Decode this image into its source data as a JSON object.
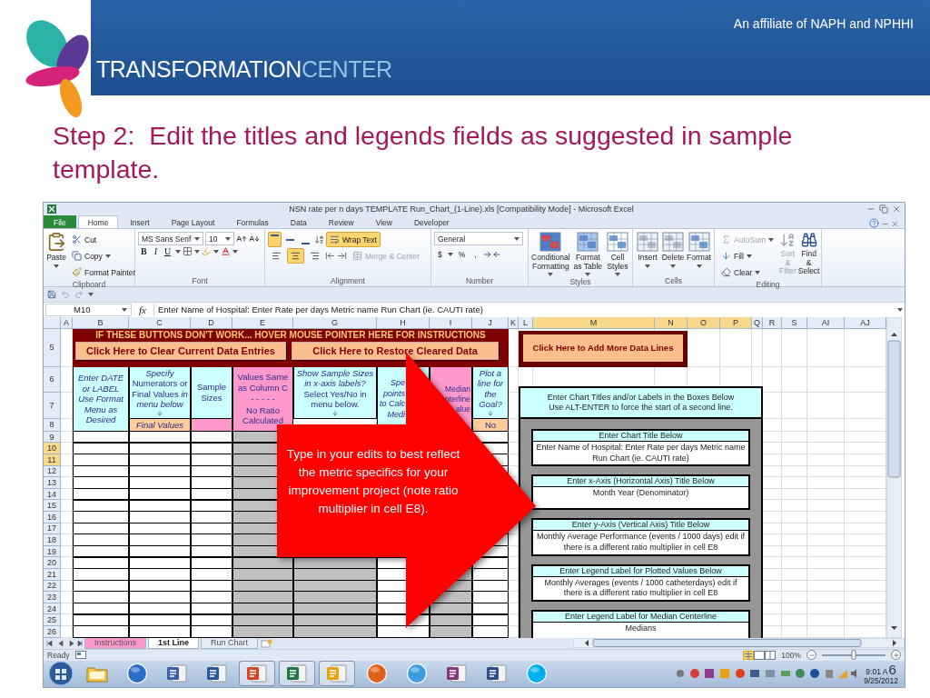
{
  "slide": {
    "affiliate": "An affiliate of NAPH and NPHHI",
    "logo_left": "TRANSFORMATION",
    "logo_right": "CENTER",
    "title": "Step 2:  Edit the titles and legends fields as suggested in sample template.",
    "callout": "Type in your edits to best reflect the metric specifics for your improvement project (note ratio multiplier in cell E8).",
    "slide_number": "6"
  },
  "window": {
    "title": "NSN rate per n days TEMPLATE Run_Chart_(1-Line).xls  [Compatibility Mode]  -  Microsoft Excel"
  },
  "tabs": [
    {
      "label": "File",
      "kind": "file",
      "selected": false
    },
    {
      "label": "Home",
      "kind": "tab",
      "selected": true
    },
    {
      "label": "Insert",
      "kind": "tab",
      "selected": false
    },
    {
      "label": "Page Layout",
      "kind": "tab",
      "selected": false
    },
    {
      "label": "Formulas",
      "kind": "tab",
      "selected": false
    },
    {
      "label": "Data",
      "kind": "tab",
      "selected": false
    },
    {
      "label": "Review",
      "kind": "tab",
      "selected": false
    },
    {
      "label": "View",
      "kind": "tab",
      "selected": false
    },
    {
      "label": "Developer",
      "kind": "tab",
      "selected": false
    }
  ],
  "ribbon": {
    "clipboard": {
      "label": "Clipboard",
      "paste": "Paste",
      "cut": "Cut",
      "copy": "Copy",
      "format_painter": "Format Painter"
    },
    "font": {
      "label": "Font",
      "name": "MS Sans Serif",
      "size": "10",
      "bold": "B",
      "italic": "I",
      "underline": "U"
    },
    "alignment": {
      "label": "Alignment",
      "vertical": [
        {
          "on": true
        },
        {
          "on": false
        },
        {
          "on": false
        }
      ],
      "horizontal": [
        {
          "on": false
        },
        {
          "on": true
        },
        {
          "on": false
        }
      ],
      "wrap_text": {
        "label": "Wrap Text",
        "on": true
      },
      "merge": {
        "label": "Merge & Center",
        "disabled": true
      }
    },
    "number": {
      "label": "Number",
      "format": "General",
      "currency": "$",
      "percent": "%",
      "comma": ","
    },
    "styles": {
      "label": "Styles",
      "items": [
        "Conditional Formatting",
        "Format as Table",
        "Cell Styles"
      ]
    },
    "cells": {
      "label": "Cells",
      "items": [
        "Insert",
        "Delete",
        "Format"
      ]
    },
    "editing": {
      "label": "Editing",
      "autosum": {
        "label": "AutoSum",
        "disabled": true
      },
      "fill": "Fill",
      "clear": "Clear",
      "sort": {
        "label": "Sort & Filter",
        "disabled": true
      },
      "find": "Find & Select"
    }
  },
  "formula_bar": {
    "name_box": "M10",
    "fx": "fx",
    "formula": "Enter Name of Hospital:  Enter Rate per days Metric name Run Chart (ie. CAUTI rate)"
  },
  "sheet": {
    "columns": [
      {
        "label": "A",
        "selected": false
      },
      {
        "label": "B",
        "selected": false
      },
      {
        "label": "C",
        "selected": false
      },
      {
        "label": "D",
        "selected": false
      },
      {
        "label": "E",
        "selected": false
      },
      {
        "label": "G",
        "selected": false
      },
      {
        "label": "H",
        "selected": false
      },
      {
        "label": "I",
        "selected": false
      },
      {
        "label": "J",
        "selected": false
      },
      {
        "label": "K",
        "selected": false
      },
      {
        "label": "L",
        "selected": false
      },
      {
        "label": "M",
        "selected": true
      },
      {
        "label": "N",
        "selected": true
      },
      {
        "label": "O",
        "selected": true
      },
      {
        "label": "P",
        "selected": true
      },
      {
        "label": "Q",
        "selected": false
      },
      {
        "label": "R",
        "selected": false
      },
      {
        "label": "S",
        "selected": false
      },
      {
        "label": "AI",
        "selected": false
      },
      {
        "label": "AJ",
        "selected": false
      }
    ],
    "rows": [
      {
        "label": "5",
        "selected": false
      },
      {
        "label": "6",
        "selected": false
      },
      {
        "label": "7",
        "selected": false
      },
      {
        "label": "8",
        "selected": false
      },
      {
        "label": "9",
        "selected": false
      },
      {
        "label": "10",
        "selected": true
      },
      {
        "label": "11",
        "selected": true
      },
      {
        "label": "12",
        "selected": false
      },
      {
        "label": "13",
        "selected": false
      },
      {
        "label": "14",
        "selected": false
      },
      {
        "label": "15",
        "selected": false
      },
      {
        "label": "16",
        "selected": false
      },
      {
        "label": "17",
        "selected": false
      },
      {
        "label": "18",
        "selected": false
      },
      {
        "label": "19",
        "selected": false
      },
      {
        "label": "20",
        "selected": false
      },
      {
        "label": "21",
        "selected": false
      },
      {
        "label": "22",
        "selected": false
      },
      {
        "label": "23",
        "selected": false
      },
      {
        "label": "24",
        "selected": false
      },
      {
        "label": "25",
        "selected": false
      },
      {
        "label": "26",
        "selected": false
      }
    ],
    "banner": "IF THESE BUTTONS DON'T WORK...  HOVER MOUSE POINTER HERE FOR INSTRUCTIONS",
    "clear_button": "Click Here to Clear Current Data Entries",
    "restore_button": "Click Here to Restore Cleared Data",
    "add_lines_button": "Click Here to Add More Data Lines",
    "headers": [
      {
        "lines": [
          "Enter DATE or LABEL Use Format Menu as Desired"
        ],
        "italic": true,
        "color": "#ccffff",
        "arrow": false
      },
      {
        "lines": [
          "*Specify* Numerators or Final Values *in menu below*"
        ],
        "italic": false,
        "color": "#ccffff",
        "arrow": true
      },
      {
        "lines": [
          "Sample Sizes"
        ],
        "italic": false,
        "color": "#ccffff",
        "arrow": false
      },
      {
        "lines": [
          "Values Same as Column C",
          "- - - - -",
          "No Ratio Calculated"
        ],
        "italic": false,
        "color": "#ff99cc",
        "arrow": false
      },
      {
        "lines": [
          "*Show Sample Sizes in x-axis labels?* Select Yes/No in menu below."
        ],
        "italic": false,
        "color": "#ccffff",
        "arrow": true
      },
      {
        "lines": [
          "Spe",
          "points",
          "to Calc",
          "Medi"
        ],
        "italic": true,
        "color": "#ccffff",
        "arrow": false
      },
      {
        "lines": [
          "Median",
          "nterline",
          "alue"
        ],
        "italic": false,
        "color": "#ff99cc",
        "arrow": false
      },
      {
        "lines": [
          "Plot a line for the Goal?"
        ],
        "italic": true,
        "color": "#ccffff",
        "arrow": true
      }
    ],
    "row_8": [
      {
        "text": "Final Values",
        "color": "#ffcc99"
      },
      {
        "color": "#ff99cc"
      },
      {
        "text": "No",
        "color": "#ffcc99"
      }
    ],
    "panel": {
      "heading": [
        "Enter Chart Titles and/or Labels in the Boxes Below",
        "Use ALT-ENTER to force the start of a second line."
      ],
      "fields": [
        {
          "label": "Enter Chart Title Below",
          "value": "Enter Name of Hospital:  Enter Rate per days Metric name Run Chart (ie. CAUTI rate)"
        },
        {
          "label": "Enter x-Axis (Horizontal Axis) Title Below",
          "value": "Month Year (Denominator)"
        },
        {
          "label": "Enter y-Axis (Vertical Axis) Title Below",
          "value": "Monthly Average Performance (events / 1000 days)  edit if there is a different ratio multiplier in cell E8"
        },
        {
          "label": "Enter Legend Label for Plotted Values Below",
          "value": "Monthly Averages (events / 1000 catheterdays)  edit if there is a different ratio multiplier in cell E8"
        },
        {
          "label": "Enter Legend Label for Median Centerline",
          "value": "Medians"
        }
      ]
    }
  },
  "sheet_tabs": [
    {
      "label": "Instructions",
      "color": "#ff99cc",
      "selected": false
    },
    {
      "label": "1st Line",
      "color": "#ffffff",
      "selected": true
    },
    {
      "label": "Run Chart",
      "color": "#e4ecf7",
      "selected": false
    }
  ],
  "status_bar": {
    "ready": "Ready",
    "zoom": {
      "label": "100%",
      "level": 0.5
    }
  },
  "taskbar": {
    "apps": [
      {
        "kind": "folder",
        "color": "#f2c84b",
        "running": false
      },
      {
        "kind": "round",
        "color": "#2a6fc9",
        "running": false
      },
      {
        "kind": "tile",
        "color": "#3b5fa8",
        "running": false
      },
      {
        "kind": "tile",
        "color": "#2b579a",
        "running": false
      },
      {
        "kind": "tile",
        "color": "#d24726",
        "running": true
      },
      {
        "kind": "tile",
        "color": "#217346",
        "running": true
      },
      {
        "kind": "tile",
        "color": "#e8a010",
        "running": true
      },
      {
        "kind": "round",
        "color": "#e0621a",
        "running": false
      },
      {
        "kind": "round",
        "color": "#3d9be0",
        "running": false
      },
      {
        "kind": "tile",
        "color": "#80397b",
        "running": false
      },
      {
        "kind": "tile",
        "color": "#2c4f8a",
        "running": false
      },
      {
        "kind": "round",
        "color": "#00aff0",
        "running": false
      }
    ],
    "time": "9:01 A",
    "date": "9/25/2012"
  }
}
